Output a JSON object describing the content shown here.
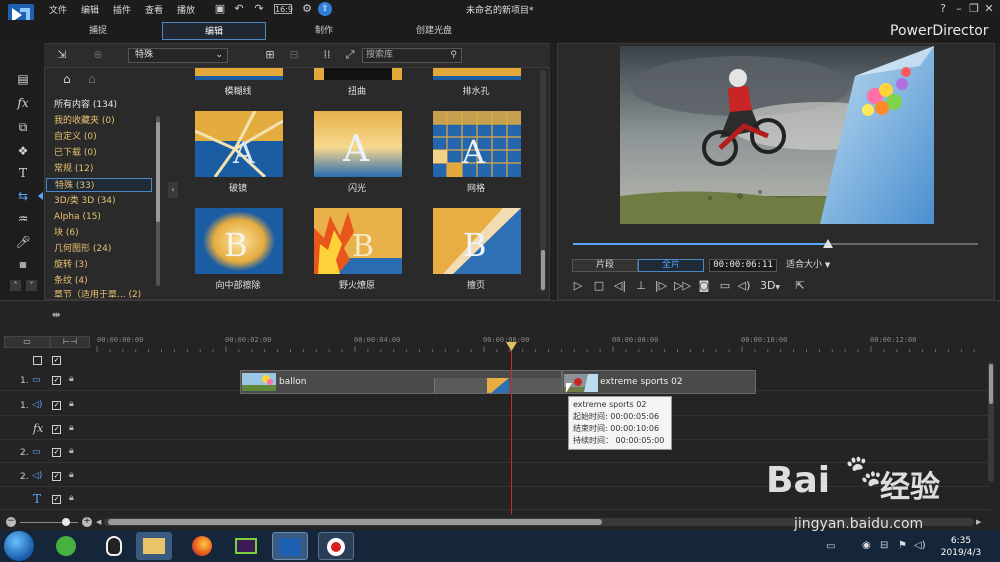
{
  "app": {
    "doc_title": "未命名的新项目*",
    "brand": "PowerDirector",
    "menus": [
      "文件",
      "编辑",
      "插件",
      "查看",
      "播放"
    ]
  },
  "tabs": [
    "捕捉",
    "编辑",
    "制作",
    "创建光盘"
  ],
  "library": {
    "filter": "特殊",
    "search_placeholder": "搜索库",
    "categories": [
      "所有内容 (134)",
      "我的收藏夹 (0)",
      "自定义 (0)",
      "已下载 (0)",
      "常规 (12)",
      "特殊 (33)",
      "3D/类 3D (34)",
      "Alpha (15)",
      "块 (6)",
      "几何图形 (24)",
      "旋转 (3)",
      "条纹 (4)",
      "章节（适用于章... (2)"
    ],
    "transitions_row0": [
      "模糊线",
      "扭曲",
      "排水孔"
    ],
    "transitions_row1": [
      "破镜",
      "闪光",
      "网格"
    ],
    "transitions_row2": [
      "向中部擦除",
      "野火燎原",
      "擅页"
    ]
  },
  "preview": {
    "mode_clip": "片段",
    "mode_full": "全片",
    "timecode": "00:00:06:11",
    "fit": "适合大小",
    "button_3d": "3D",
    "progress": 0.63
  },
  "timeline": {
    "ruler": [
      "00:00:00:00",
      "00:00:02:00",
      "00:00:04:00",
      "00:00:06:00",
      "00:00:08:00",
      "00:00:10:00",
      "00:00:12:00"
    ],
    "tracks": [
      {
        "num": "1.",
        "type": "video"
      },
      {
        "num": "1.",
        "type": "audio"
      },
      {
        "num": "",
        "type": "fx"
      },
      {
        "num": "2.",
        "type": "video"
      },
      {
        "num": "2.",
        "type": "audio"
      },
      {
        "num": "",
        "type": "title"
      }
    ],
    "clip1": "ballon",
    "clip2": "extreme sports 02",
    "tooltip": {
      "name": "extreme sports 02",
      "start": "起始时间: 00:00:05:06",
      "end": "结束时间: 00:00:10:06",
      "duration": "持续时间： 00:00:05:00"
    }
  },
  "taskbar": {
    "time": "6:35",
    "date": "2019/4/3"
  },
  "watermark": {
    "brand": "Bai",
    "brand2": "经验",
    "url": "jingyan.baidu.com"
  },
  "colors": {
    "accent": "#5aa6ff",
    "category": "#e8c270",
    "playhead": "#c03030"
  }
}
